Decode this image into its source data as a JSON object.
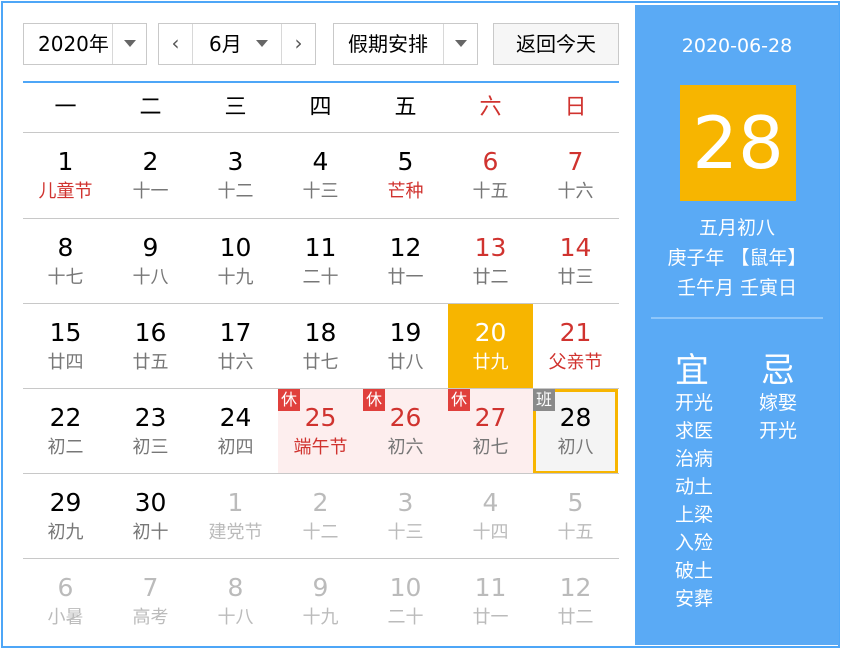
{
  "controls": {
    "year": "2020年",
    "month": "6月",
    "prev_icon": "chevron-left-icon",
    "next_icon": "chevron-right-icon",
    "holiday_select": "假期安排",
    "today_button": "返回今天"
  },
  "weekdays": [
    "一",
    "二",
    "三",
    "四",
    "五",
    "六",
    "日"
  ],
  "weeks": [
    [
      {
        "day": "1",
        "lunar": "儿童节",
        "fest": true
      },
      {
        "day": "2",
        "lunar": "十一"
      },
      {
        "day": "3",
        "lunar": "十二"
      },
      {
        "day": "4",
        "lunar": "十三"
      },
      {
        "day": "5",
        "lunar": "芒种",
        "fest": true
      },
      {
        "day": "6",
        "lunar": "十五",
        "weekend": true
      },
      {
        "day": "7",
        "lunar": "十六",
        "weekend": true
      }
    ],
    [
      {
        "day": "8",
        "lunar": "十七"
      },
      {
        "day": "9",
        "lunar": "十八"
      },
      {
        "day": "10",
        "lunar": "十九"
      },
      {
        "day": "11",
        "lunar": "二十"
      },
      {
        "day": "12",
        "lunar": "廿一"
      },
      {
        "day": "13",
        "lunar": "廿二",
        "weekend": true
      },
      {
        "day": "14",
        "lunar": "廿三",
        "weekend": true
      }
    ],
    [
      {
        "day": "15",
        "lunar": "廿四"
      },
      {
        "day": "16",
        "lunar": "廿五"
      },
      {
        "day": "17",
        "lunar": "廿六"
      },
      {
        "day": "18",
        "lunar": "廿七"
      },
      {
        "day": "19",
        "lunar": "廿八"
      },
      {
        "day": "20",
        "lunar": "廿九",
        "weekend": true,
        "selected": true
      },
      {
        "day": "21",
        "lunar": "父亲节",
        "weekend": true,
        "fest": true
      }
    ],
    [
      {
        "day": "22",
        "lunar": "初二"
      },
      {
        "day": "23",
        "lunar": "初三"
      },
      {
        "day": "24",
        "lunar": "初四"
      },
      {
        "day": "25",
        "lunar": "端午节",
        "fest": true,
        "holiday": true,
        "badge": "休",
        "weekend": true
      },
      {
        "day": "26",
        "lunar": "初六",
        "holiday": true,
        "badge": "休",
        "weekend": true
      },
      {
        "day": "27",
        "lunar": "初七",
        "holiday": true,
        "badge": "休",
        "weekend": true
      },
      {
        "day": "28",
        "lunar": "初八",
        "today": true,
        "badge": "班"
      }
    ],
    [
      {
        "day": "29",
        "lunar": "初九"
      },
      {
        "day": "30",
        "lunar": "初十"
      },
      {
        "day": "1",
        "lunar": "建党节",
        "other": true
      },
      {
        "day": "2",
        "lunar": "十二",
        "other": true
      },
      {
        "day": "3",
        "lunar": "十三",
        "other": true
      },
      {
        "day": "4",
        "lunar": "十四",
        "other": true
      },
      {
        "day": "5",
        "lunar": "十五",
        "other": true
      }
    ],
    [
      {
        "day": "6",
        "lunar": "小暑",
        "other": true
      },
      {
        "day": "7",
        "lunar": "高考",
        "other": true
      },
      {
        "day": "8",
        "lunar": "十八",
        "other": true
      },
      {
        "day": "9",
        "lunar": "十九",
        "other": true
      },
      {
        "day": "10",
        "lunar": "二十",
        "other": true
      },
      {
        "day": "11",
        "lunar": "廿一",
        "other": true
      },
      {
        "day": "12",
        "lunar": "廿二",
        "other": true
      }
    ]
  ],
  "panel": {
    "date": "2020-06-28",
    "big_day": "28",
    "lunar_date": "五月初八",
    "year_line": "庚子年 【鼠年】",
    "ganzhi_line": "壬午月 壬寅日",
    "yi_title": "宜",
    "ji_title": "忌",
    "yi": [
      "开光",
      "求医",
      "治病",
      "动土",
      "上梁",
      "入殓",
      "破土",
      "安葬"
    ],
    "ji": [
      "嫁娶",
      "开光"
    ]
  },
  "colors": {
    "accent_blue": "#4ea6f7",
    "panel_blue": "#5aaaf5",
    "highlight_orange": "#f7b500",
    "festival_red": "#d0332f",
    "holiday_bg": "#fdeeee"
  }
}
